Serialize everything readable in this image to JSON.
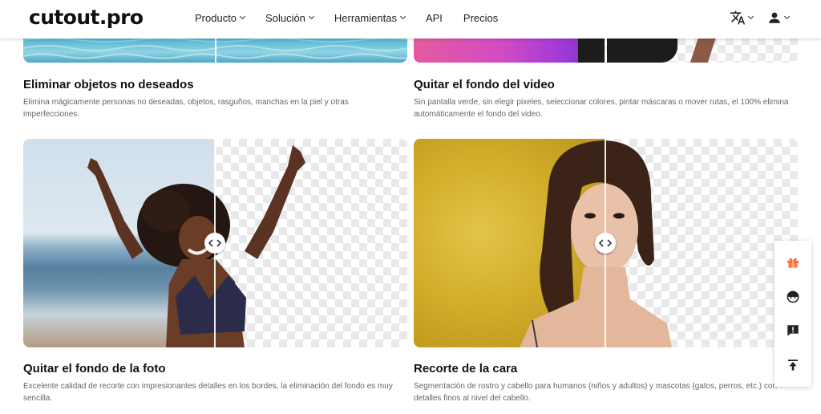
{
  "brand": {
    "logo": "cutout.pro"
  },
  "nav": {
    "items": [
      {
        "label": "Producto",
        "dropdown": true
      },
      {
        "label": "Solución",
        "dropdown": true
      },
      {
        "label": "Herramientas",
        "dropdown": true
      },
      {
        "label": "API",
        "dropdown": false
      },
      {
        "label": "Precios",
        "dropdown": false
      }
    ],
    "language_icon": "translate-icon",
    "user_icon": "user-icon"
  },
  "cards": [
    {
      "title": "Eliminar objetos no deseados",
      "description": "Elimina mágicamente personas no deseadas, objetos, rasguños, manchas en la piel y otras imperfecciones."
    },
    {
      "title": "Quitar el fondo del video",
      "description": "Sin pantalla verde, sin elegir pixeles, seleccionar colores, pintar máscaras o mover rutas, el 100% elimina automáticamente el fondo del video."
    },
    {
      "title": "Quitar el fondo de la foto",
      "description": "Excelente calidad de recorte con impresionantes detalles en los bordes, la eliminación del fondo es muy sencilla."
    },
    {
      "title": "Recorte de la cara",
      "description": "Segmentación de rostro y cabello para humanos (niños y adultos) y mascotas (gatos, perros, etc.) con detalles finos al nivel del cabello."
    }
  ],
  "float_bar": {
    "buttons": [
      "gift-icon",
      "support-agent-icon",
      "feedback-icon",
      "back-to-top-icon"
    ]
  },
  "colors": {
    "accent_gift": "#ff5a3c",
    "text_primary": "#111111",
    "text_secondary": "#666666"
  }
}
